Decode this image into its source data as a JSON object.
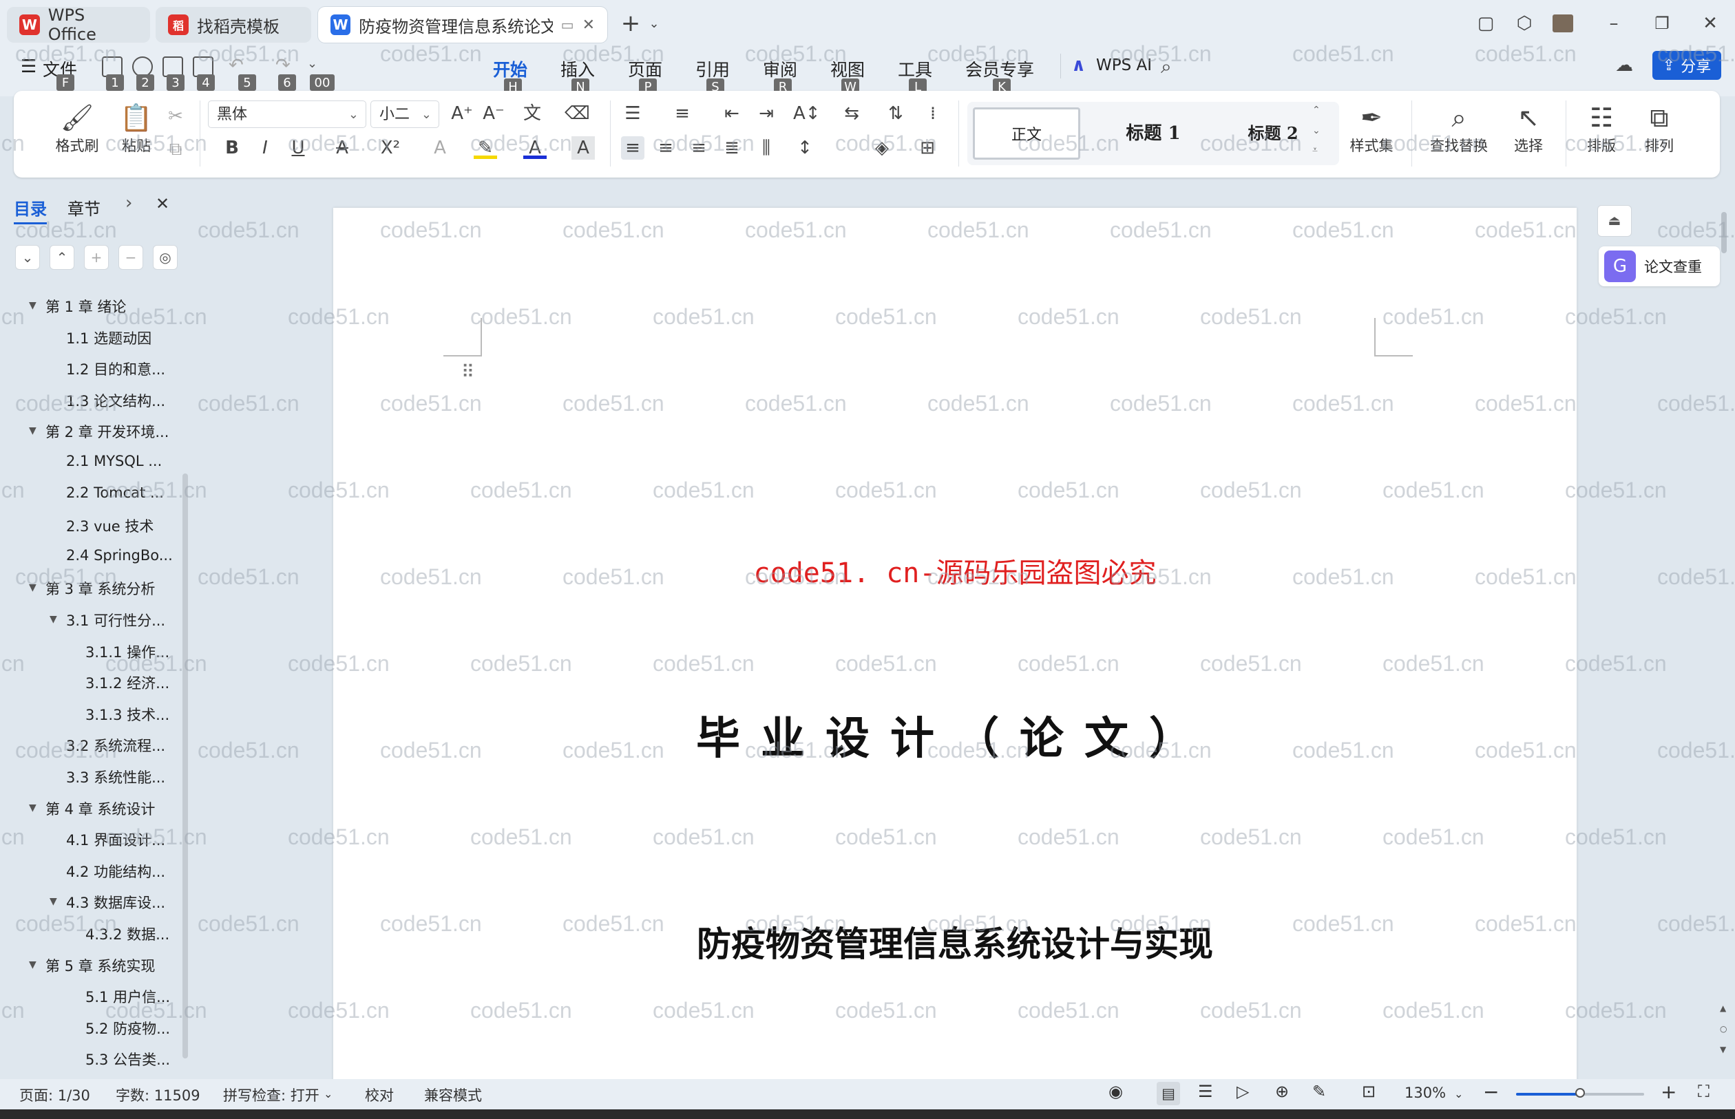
{
  "titlebar": {
    "tabs": [
      {
        "label": "WPS Office",
        "logo": "W"
      },
      {
        "label": "找稻壳模板",
        "logo": "稻"
      },
      {
        "label": "防疫物资管理信息系统论文.do",
        "logo": "W"
      }
    ],
    "new_tab": "+",
    "window_controls": {
      "minimize": "–",
      "restore": "❐",
      "close": "✕"
    }
  },
  "menu": {
    "file": "文件",
    "file_key": "F",
    "quick_keys": [
      "1",
      "2",
      "3",
      "4",
      "5",
      "6",
      "00"
    ],
    "items": [
      {
        "label": "开始",
        "key": "H"
      },
      {
        "label": "插入",
        "key": "N"
      },
      {
        "label": "页面",
        "key": "P"
      },
      {
        "label": "引用",
        "key": "S"
      },
      {
        "label": "审阅",
        "key": "R"
      },
      {
        "label": "视图",
        "key": "W"
      },
      {
        "label": "工具",
        "key": "L"
      },
      {
        "label": "会员专享",
        "key": "K"
      }
    ],
    "wps_ai": "WPS AI",
    "share": "分享"
  },
  "ribbon": {
    "format_painter": "格式刷",
    "paste": "粘贴",
    "font_name": "黑体",
    "font_size": "小二",
    "styles": {
      "normal": "正文",
      "heading1": "标题 1",
      "heading2": "标题 2"
    },
    "style_set": "样式集",
    "find_replace": "查找替换",
    "select": "选择",
    "layout": "排版",
    "arrange": "排列"
  },
  "nav": {
    "tab_toc": "目录",
    "tab_chapter": "章节",
    "toc": [
      {
        "label": "第 1 章  绪论",
        "level": 0,
        "tri": true
      },
      {
        "label": "1.1 选题动因",
        "level": 1
      },
      {
        "label": "1.2 目的和意...",
        "level": 1
      },
      {
        "label": "1.3 论文结构...",
        "level": 1
      },
      {
        "label": "第 2 章  开发环境...",
        "level": 0,
        "tri": true
      },
      {
        "label": "2.1 MYSQL ...",
        "level": 1
      },
      {
        "label": "2.2 Tomcat ...",
        "level": 1
      },
      {
        "label": "2.3 vue 技术",
        "level": 1
      },
      {
        "label": "2.4 SpringBo...",
        "level": 1
      },
      {
        "label": "第 3 章  系统分析",
        "level": 0,
        "tri": true
      },
      {
        "label": "3.1 可行性分...",
        "level": 1,
        "tri": true
      },
      {
        "label": "3.1.1 操作...",
        "level": 2
      },
      {
        "label": "3.1.2 经济...",
        "level": 2
      },
      {
        "label": "3.1.3 技术...",
        "level": 2
      },
      {
        "label": "3.2 系统流程...",
        "level": 1
      },
      {
        "label": "3.3 系统性能...",
        "level": 1
      },
      {
        "label": "第 4 章  系统设计",
        "level": 0,
        "tri": true
      },
      {
        "label": "4.1 界面设计...",
        "level": 1
      },
      {
        "label": "4.2 功能结构...",
        "level": 1
      },
      {
        "label": "4.3 数据库设...",
        "level": 1,
        "tri": true
      },
      {
        "label": "4.3.2  数据...",
        "level": 2
      },
      {
        "label": "第 5 章  系统实现",
        "level": 0,
        "tri": true
      },
      {
        "label": "5.1 用户信...",
        "level": 2
      },
      {
        "label": "5.2  防疫物...",
        "level": 2
      },
      {
        "label": "5.3 公告类...",
        "level": 2
      }
    ]
  },
  "document": {
    "watermark_line": "code51. cn-源码乐园盗图必究",
    "title": "毕业设计（论文）",
    "subtitle": "防疫物资管理信息系统设计与实现",
    "watermark": "code51.cn"
  },
  "right_panel": {
    "paper_check": "论文查重"
  },
  "status": {
    "page": "页面: 1/30",
    "words": "字数: 11509",
    "spell": "拼写检查: 打开",
    "proof": "校对",
    "compat": "兼容模式",
    "zoom": "130%",
    "zoom_level": 0.5
  },
  "colors": {
    "accent": "#1a5fd6",
    "wps_red": "#e0322d",
    "watermark_red": "#e02020"
  }
}
